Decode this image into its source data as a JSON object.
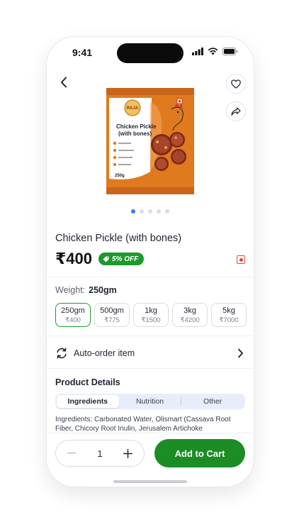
{
  "status_bar": {
    "time": "9:41"
  },
  "product": {
    "name": "Chicken Pickle (with bones)",
    "price": "₹400",
    "discount_badge": "5% OFF",
    "image_slides": 5,
    "active_slide": 1,
    "package": {
      "brand": "RAJA",
      "title_line1": "Chicken Pickle",
      "title_line2": "(with bones)",
      "net_weight": "250g"
    }
  },
  "weight": {
    "label": "Weight:",
    "selected": "250gm"
  },
  "sizes": [
    {
      "weight": "250gm",
      "price": "₹400",
      "selected": true
    },
    {
      "weight": "500gm",
      "price": "₹775",
      "selected": false
    },
    {
      "weight": "1kg",
      "price": "₹1500",
      "selected": false
    },
    {
      "weight": "3kg",
      "price": "₹4200",
      "selected": false
    },
    {
      "weight": "5kg",
      "price": "₹7000",
      "selected": false
    }
  ],
  "auto_order": {
    "label": "Auto-order item"
  },
  "details": {
    "title": "Product Details",
    "tabs": [
      "Ingredients",
      "Nutrition",
      "Other"
    ],
    "active_tab": "Ingredients",
    "ingredients_text": "Ingredients: Carbonated Water, Olismart (Cassava Root Fiber, Chicory Root Inulin, Jerusalem Artichoke"
  },
  "cart": {
    "quantity": "1",
    "add_label": "Add to Cart"
  },
  "colors": {
    "accent_green": "#1b8d24",
    "badge_green": "#1b9a2d",
    "dot_active": "#2f7df6",
    "pack_orange": "#e07a1f"
  }
}
